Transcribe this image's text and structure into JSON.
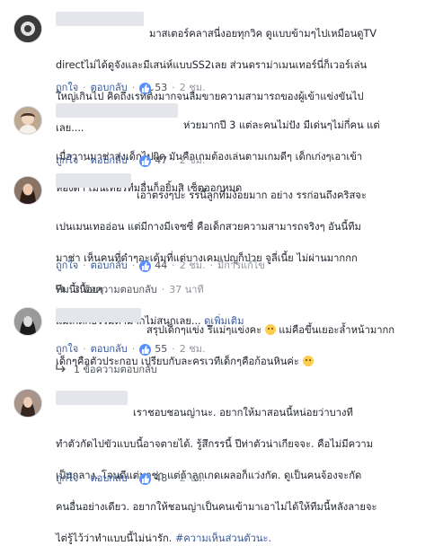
{
  "comments": [
    {
      "lines": [
        "มาสเตอร์คลาสนี่งอยทุกวิค ดูแบบข้ามๆไปเหมือนดูTV",
        "directไม่ได้ดูจังและมีเสน่ห์แบบSS2เลย ส่วนดราม่าเมนเทอร์นี่ก็เวอร์เล่น",
        "ใหญ่เกินไป คิดถึงเรทติ้งมากจนลืมขายความสามารถของผู้เข้าแข่งขันไป",
        "เลย...."
      ],
      "like_label": "ถูกใจ",
      "reply_label": "ตอบกลับ",
      "like_count": "53",
      "time": "2 ชม."
    },
    {
      "lines": [
        "ห่วยมากปี 3 แต่ละคนไม่ปัง มีเด่นๆไม่กี่คน แต่",
        "เมื่อวานมาช่าส่งเด็กไปผิด มันคือเกมต้องเล่นตามเกมดีๆ เด็กเก่งๆเอาเข้า",
        "ห้องดำ เมนเทอร์ทีมอื่นก็อยิ้มสิ เซ็ตออกหมด"
      ],
      "like_label": "ถูกใจ",
      "reply_label": "ตอบกลับ",
      "like_count": "47",
      "time": "2 ชม."
    },
    {
      "lines": [
        "เอาตรงๆปะ รรนี้ลูกทีมง้อยมาก อย่าง รรก่อนถึงคริสจะ",
        "เปนเมนเทออ่อน แต่มีกางมีเจซซี่ คือเด็กสวยความสามารถจริงๆ อันนี้ทีม",
        "มาช่า เห็นคนที่ดำๆอะเด้มที่แต่บางเคมเปญก็ป่วย จูลี่เนี้ย ไม่ผ่านมากกก",
        "ทีมนี้เนื้อยๆ",
        "แม่เกดก็ธรรมดามากไม่สนุกเลย..."
      ],
      "see_more": "ดูเพิ่มเติม",
      "like_label": "ถูกใจ",
      "reply_label": "ตอบกลับ",
      "like_count": "44",
      "time": "2 ชม.",
      "edited": "มีการแก้ไข",
      "replies_label": "3 ข้อความตอบกลับ",
      "replies_time": "37 นาที"
    },
    {
      "lines_first": "สรุปเด็กๆแข่ง รึแม่ๆแข่งคะ",
      "lines_first_tail": "แม่คือขึ้นเยอะล้ำหน้ามากก",
      "line_second": "เด็กๆคือตัวประกอบ เปรียบกับละครเวทีเด็กๆคือก้อนหินค่ะ",
      "like_label": "ถูกใจ",
      "reply_label": "ตอบกลับ",
      "like_count": "55",
      "time": "2 ชม.",
      "replies_label": "1 ข้อความตอบกลับ"
    },
    {
      "lines": [
        "เราชอบชอนญ่านะ. อยากให้มาสอนนี้หน่อยว่าบางที",
        "ทำตัวกัดไปขัวแบบนี้อาจตายได้. รู้สึกรรนี้ ปีท่าตัวน่าเกียจจะ. คือไม่มีความ",
        "เป็นกลาง. โจนดีแต่มาช่า แต่ถ้าลูกเกดเผลอก็แว่งกัด. ดูเป็นคนจ้องจะกัด",
        "คนอื่นอย่างเดียว. อยากให้ชอนญ่าเป็นคนเข้ามาเอาไม่ได้ให้ทีมนี้หลังลายจะ",
        "ไต่รู้ไว้ว่าทำแบบนี้ไม่น่ารัก."
      ],
      "hashtag": "#ความเห็นส่วนตัวนะ.",
      "like_label": "ถูกใจ",
      "reply_label": "ตอบกลับ",
      "like_count": "48",
      "time": "2 ชม."
    }
  ],
  "colors": {
    "link": "#385898",
    "like_badge": "#5890ff",
    "meta": "#90949c"
  }
}
